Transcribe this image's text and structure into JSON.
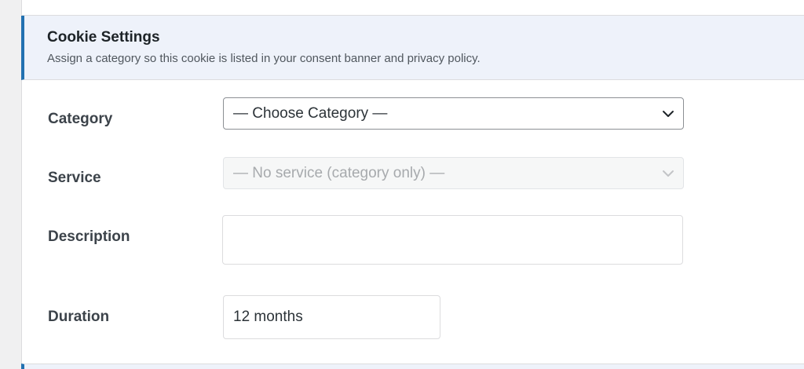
{
  "section": {
    "title": "Cookie Settings",
    "subtitle": "Assign a category so this cookie is listed in your consent banner and privacy policy."
  },
  "fields": {
    "category": {
      "label": "Category",
      "selected": "— Choose Category —",
      "icon": "chevron-down-icon"
    },
    "service": {
      "label": "Service",
      "selected": "— No service (category only) —",
      "disabled": true,
      "icon": "chevron-down-icon"
    },
    "description": {
      "label": "Description",
      "value": ""
    },
    "duration": {
      "label": "Duration",
      "value": "12 months"
    }
  },
  "colors": {
    "accent": "#2271b1",
    "header_bg": "#eef2fa",
    "border": "#dcdcde"
  }
}
